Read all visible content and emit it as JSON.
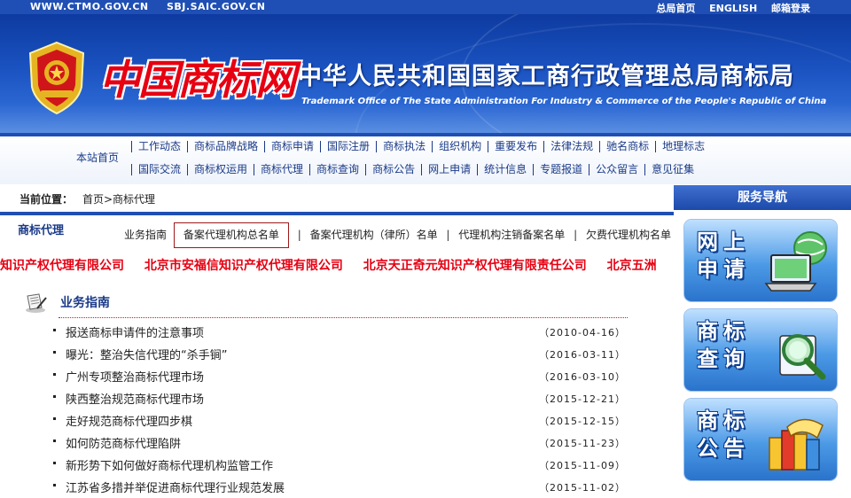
{
  "topbar": {
    "sites": [
      "WWW.CTMO.GOV.CN",
      "SBJ.SAIC.GOV.CN"
    ],
    "links": [
      "总局首页",
      "ENGLISH",
      "邮箱登录"
    ]
  },
  "banner": {
    "logo_text": "中国商标网",
    "bureau_cn": "中华人民共和国国家工商行政管理总局商标局",
    "bureau_en": "Trademark Office of The State Administration For Industry & Commerce of the People's Republic of China"
  },
  "nav": {
    "home": "本站首页",
    "row1": [
      "工作动态",
      "商标品牌战略",
      "商标申请",
      "国际注册",
      "商标执法",
      "组织机构",
      "重要发布",
      "法律法规",
      "驰名商标",
      "地理标志"
    ],
    "row2": [
      "国际交流",
      "商标权运用",
      "商标代理",
      "商标查询",
      "商标公告",
      "网上申请",
      "统计信息",
      "专题报道",
      "公众留言",
      "意见征集"
    ]
  },
  "breadcrumb": {
    "label": "当前位置：",
    "path": "首页>商标代理"
  },
  "subnav": {
    "title": "商标代理",
    "items": [
      "业务指南",
      "备案代理机构总名单",
      "备案代理机构（律所）名单",
      "代理机构注销备案名单",
      "欠费代理机构名单"
    ]
  },
  "marquee": [
    "知识产权代理有限公司",
    "北京市安福信知识产权代理有限公司",
    "北京天正奇元知识产权代理有限责任公司",
    "北京五洲"
  ],
  "guide": {
    "title": "业务指南",
    "items": [
      {
        "title": "报送商标申请件的注意事项",
        "date": "（2010-04-16）"
      },
      {
        "title": "曝光：整治失信代理的“杀手锏”",
        "date": "（2016-03-11）"
      },
      {
        "title": "广州专项整治商标代理市场",
        "date": "（2016-03-10）"
      },
      {
        "title": "陕西整治规范商标代理市场",
        "date": "（2015-12-21）"
      },
      {
        "title": "走好规范商标代理四步棋",
        "date": "（2015-12-15）"
      },
      {
        "title": "如何防范商标代理陷阱",
        "date": "（2015-11-23）"
      },
      {
        "title": "新形势下如何做好商标代理机构监管工作",
        "date": "（2015-11-09）"
      },
      {
        "title": "江苏省多措并举促进商标代理行业规范发展",
        "date": "（2015-11-02）"
      }
    ]
  },
  "side": {
    "title": "服务导航",
    "cards": [
      {
        "line1": "网上",
        "line2": "申请"
      },
      {
        "line1": "商标",
        "line2": "查询"
      },
      {
        "line1": "商标",
        "line2": "公告"
      }
    ]
  },
  "colors": {
    "brand_blue": "#1f4fb4",
    "accent_red": "#e60012",
    "nav_text": "#1a3a88"
  }
}
